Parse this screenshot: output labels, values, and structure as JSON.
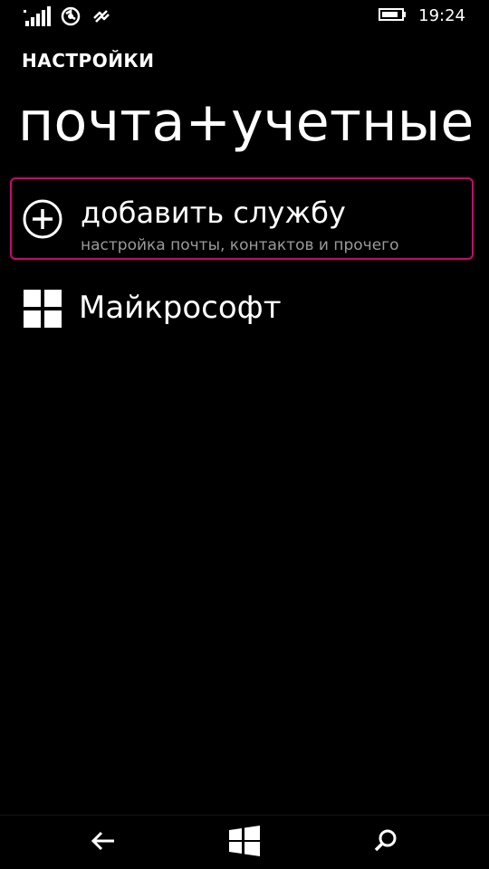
{
  "status_bar": {
    "time": "19:24",
    "icons": [
      "signal-strength-icon",
      "data-saver-icon",
      "vibrate-icon",
      "battery-icon"
    ]
  },
  "header": {
    "app_title": "НАСТРОЙКИ",
    "page_title": "почта+учетные записи"
  },
  "add_service": {
    "label": "добавить службу",
    "description": "настройка почты, контактов и прочего",
    "icon": "add-circle-icon",
    "accent_color": "#d80073"
  },
  "accounts": [
    {
      "label": "Майкрософт",
      "icon": "microsoft-logo-icon"
    }
  ],
  "nav_bar": {
    "buttons": [
      "back-icon",
      "windows-start-icon",
      "search-icon"
    ]
  },
  "colors": {
    "background": "#000000",
    "text": "#ffffff",
    "subtext": "#9a9a9a",
    "accent": "#d80073"
  }
}
